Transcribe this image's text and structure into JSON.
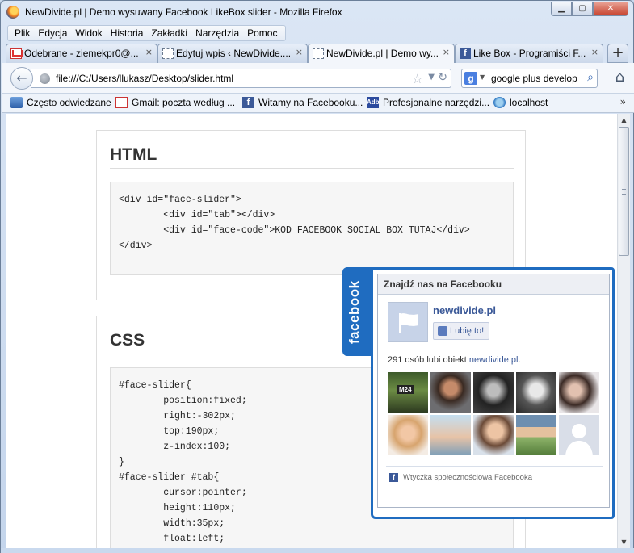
{
  "window": {
    "title": "NewDivide.pl | Demo wysuwany Facebook LikeBox slider - Mozilla Firefox",
    "buttons": {
      "minimize": "▁",
      "maximize": "▢",
      "close": "✕"
    }
  },
  "menu": [
    "Plik",
    "Edycja",
    "Widok",
    "Historia",
    "Zakładki",
    "Narzędzia",
    "Pomoc"
  ],
  "tabs": [
    {
      "label": "Odebrane - ziemekpr0@...",
      "icon": "gmail-icon",
      "close": "×"
    },
    {
      "label": "Edytuj wpis ‹ NewDivide....",
      "icon": "page-icon",
      "close": "×"
    },
    {
      "label": "NewDivide.pl | Demo wy...",
      "icon": "page-icon",
      "close": "×"
    },
    {
      "label": "Like Box - Programiści F...",
      "icon": "facebook-icon",
      "close": "×"
    }
  ],
  "new_tab": "+",
  "nav": {
    "back": "←",
    "url": "file:///C:/Users/llukasz/Desktop/slider.html",
    "star": "☆",
    "dropdown": "▼",
    "reload": "↻",
    "search_engine": "g",
    "search_dropdown": "▼",
    "search_value": "google plus develop",
    "search_button": "⌕",
    "home": "⌂"
  },
  "bookmarks": [
    {
      "label": "Często odwiedzane",
      "icon": "star-bookmark-icon"
    },
    {
      "label": "Gmail: poczta według ...",
      "icon": "gmail-icon"
    },
    {
      "label": "Witamy na Facebooku...",
      "icon": "facebook-icon"
    },
    {
      "label": "Profesjonalne narzędzi...",
      "icon": "adobe-icon",
      "short": "Adb"
    },
    {
      "label": "localhost",
      "icon": "localhost-icon"
    }
  ],
  "bookmarks_more": "»",
  "scrollbar": {
    "up": "▲",
    "down": "▼"
  },
  "page": {
    "html_section": {
      "heading": "HTML",
      "code": "<div id=\"face-slider\">\n        <div id=\"tab\"></div>\n        <div id=\"face-code\">KOD FACEBOOK SOCIAL BOX TUTAJ</div>\n</div>"
    },
    "css_section": {
      "heading": "CSS",
      "code": "#face-slider{\n        position:fixed;\n        right:-302px;\n        top:190px;\n        z-index:100;\n}\n#face-slider #tab{\n        cursor:pointer;\n        height:110px;\n        width:35px;\n        float:left;"
    }
  },
  "facebook": {
    "tab_label": "facebook",
    "header": "Znajdź nas na Facebooku",
    "page_name": "newdivide.pl",
    "f_letter": "f",
    "like_button": "Lubię to!",
    "likes_prefix": "291 osób lubi obiekt ",
    "likes_link": "newdivide.pl",
    "likes_suffix": ".",
    "fan_badge": "M24",
    "footer": "Wtyczka społecznościowa Facebooka",
    "brand_color": "#1f6cc0"
  }
}
